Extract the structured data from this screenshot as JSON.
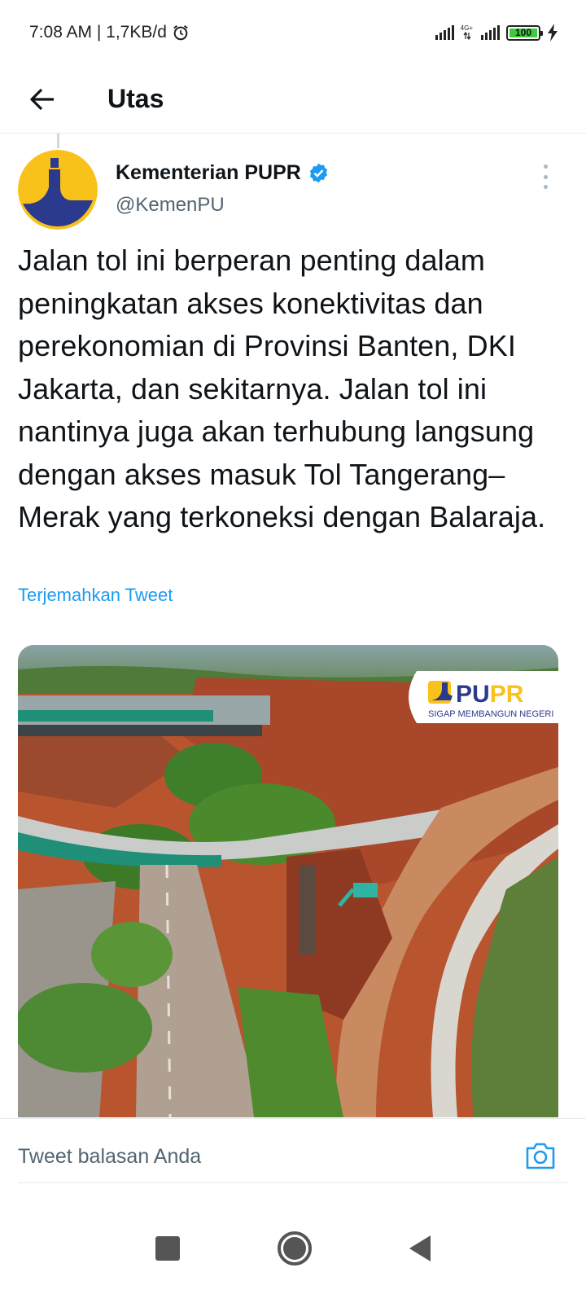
{
  "status_bar": {
    "time_info": "7:08 AM | 1,7KB/d",
    "alarm_icon": "alarm-clock-icon",
    "network_label": "4G+",
    "battery_level": "100",
    "charging_icon": "lightning-icon"
  },
  "header": {
    "back_icon": "arrow-left-icon",
    "title": "Utas"
  },
  "tweet": {
    "author_name": "Kementerian PUPR",
    "verified_icon": "verified-badge-icon",
    "handle": "@KemenPU",
    "more_icon": "more-vertical-icon",
    "text": "Jalan tol ini berperan penting dalam peningkatan akses konektivitas dan perekonomian di Provinsi Banten, DKI Jakarta, dan sekitarnya. Jalan tol ini nantinya juga akan terhubung langsung dengan akses masuk Tol Tangerang–Merak yang terkoneksi dengan Balaraja.",
    "translate_label": "Terjemahkan Tweet",
    "media": {
      "watermark_brand": "PUPR",
      "watermark_tagline": "SIGAP MEMBANGUN NEGERI"
    }
  },
  "reply": {
    "placeholder": "Tweet balasan Anda",
    "camera_icon": "camera-icon"
  },
  "navigation": {
    "recents_icon": "square-icon",
    "home_icon": "circle-icon",
    "back_icon": "triangle-back-icon"
  },
  "colors": {
    "link": "#1d9bf0",
    "verified": "#1d9bf0",
    "avatar_bg": "#f9c21a",
    "avatar_mark": "#2b3a8c",
    "battery": "#3ec93e"
  }
}
